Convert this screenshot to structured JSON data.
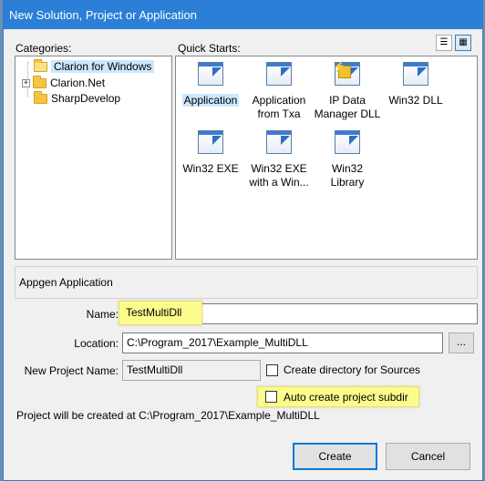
{
  "window": {
    "title": "New Solution, Project or Application"
  },
  "categories": {
    "label": "Categories:",
    "items": [
      {
        "label": "Clarion for Windows",
        "selected": true
      },
      {
        "label": "Clarion.Net",
        "expander": "+"
      },
      {
        "label": "SharpDevelop"
      }
    ]
  },
  "quick_starts": {
    "label": "Quick Starts:",
    "items": [
      {
        "label_line1": "Application",
        "label_line2": "",
        "icon": "application-window-icon",
        "selected": true
      },
      {
        "label_line1": "Application",
        "label_line2": "from Txa",
        "icon": "application-window-icon"
      },
      {
        "label_line1": "IP Data",
        "label_line2": "Manager DLL",
        "icon": "ip-data-manager-icon"
      },
      {
        "label_line1": "Win32 DLL",
        "label_line2": "",
        "icon": "application-window-icon"
      },
      {
        "label_line1": "Win32 EXE",
        "label_line2": "",
        "icon": "application-window-icon"
      },
      {
        "label_line1": "Win32 EXE",
        "label_line2": "with a Win...",
        "icon": "application-window-icon"
      },
      {
        "label_line1": "Win32",
        "label_line2": "Library",
        "icon": "application-window-icon"
      }
    ],
    "view_buttons": {
      "list_icon": "list-view-icon",
      "large_icon": "large-icons-view-icon"
    }
  },
  "description": "Appgen Application",
  "form": {
    "name_label": "Name:",
    "name_value": "TestMultiDll",
    "location_label": "Location:",
    "location_value": "C:\\Program_2017\\Example_MultiDLL",
    "browse_label": "...",
    "new_project_label": "New Project Name:",
    "new_project_value": "TestMultiDll",
    "create_dir_label": "Create directory for Sources",
    "auto_subdir_label": "Auto create project subdir",
    "summary": "Project will be created at C:\\Program_2017\\Example_MultiDLL"
  },
  "buttons": {
    "create": "Create",
    "cancel": "Cancel"
  },
  "colors": {
    "titlebar": "#2b7fd6",
    "highlight": "#fcfc8d",
    "selection": "#cce8ff",
    "default_button_border": "#0078d7"
  }
}
